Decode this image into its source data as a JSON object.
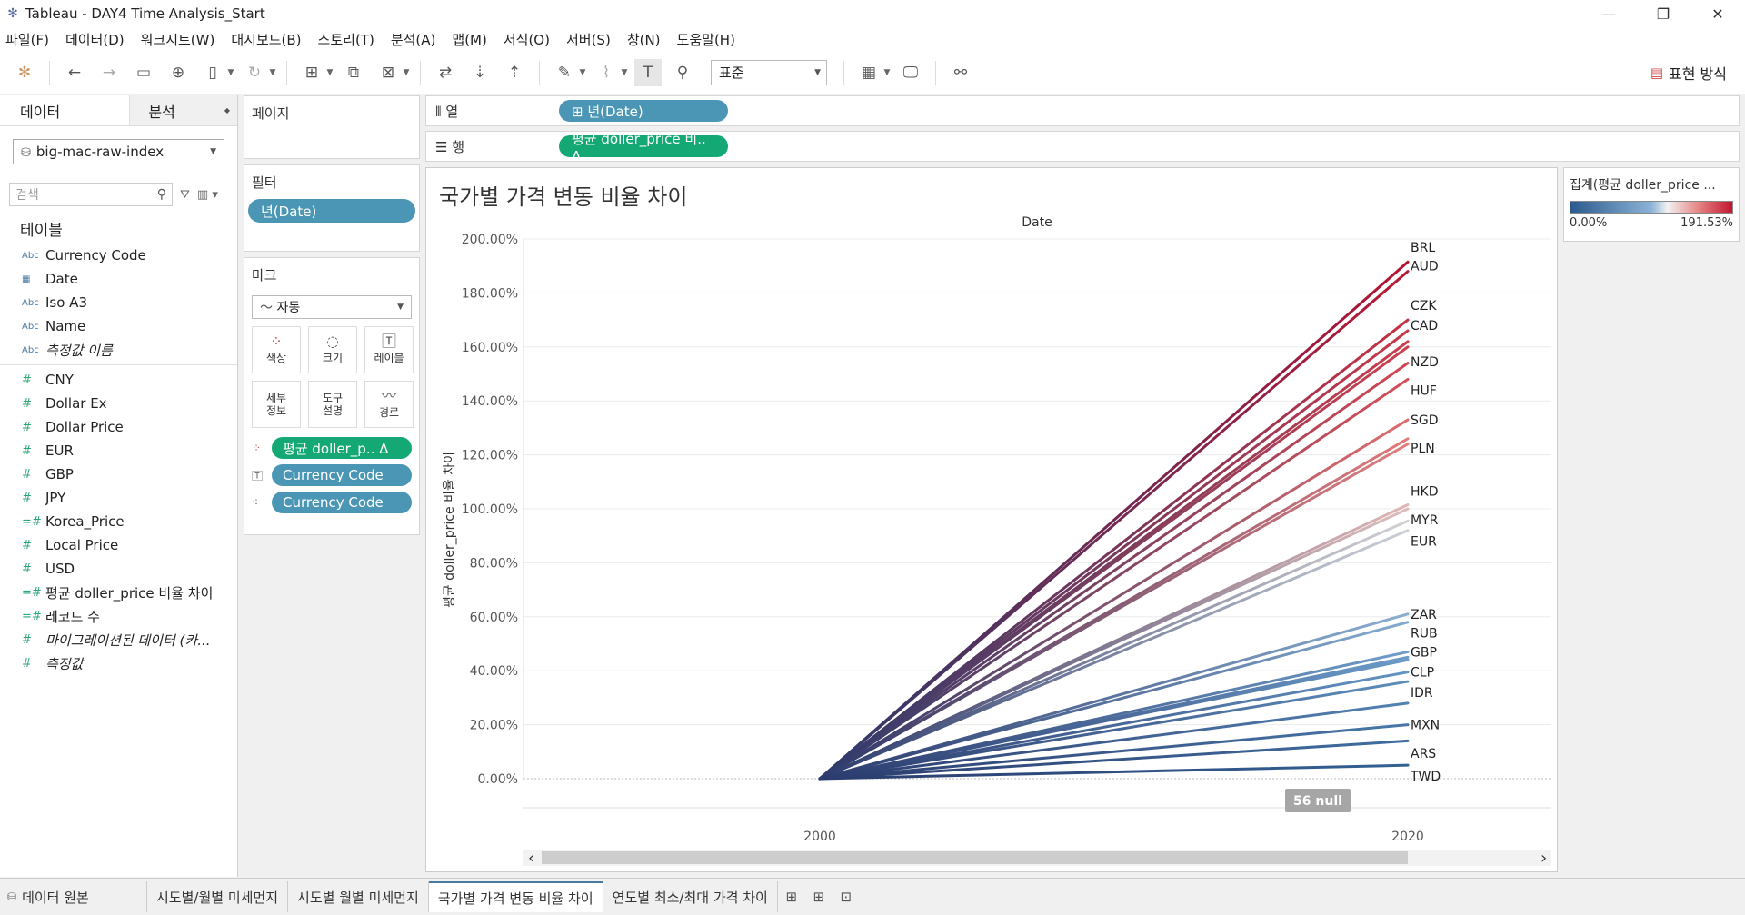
{
  "window": {
    "title": "Tableau - DAY4 Time Analysis_Start"
  },
  "menu": [
    "파일(F)",
    "데이터(D)",
    "워크시트(W)",
    "대시보드(B)",
    "스토리(T)",
    "분석(A)",
    "맵(M)",
    "서식(O)",
    "서버(S)",
    "창(N)",
    "도움말(H)"
  ],
  "toolbar": {
    "fit_value": "표준",
    "show_me_label": "표현 방식"
  },
  "left_pane": {
    "tabs": [
      "데이터",
      "분석"
    ],
    "datasource": "big-mac-raw-index",
    "search_placeholder": "검색",
    "section_title": "테이블",
    "dimensions": [
      {
        "type": "Abc",
        "name": "Currency Code"
      },
      {
        "type": "date",
        "name": "Date"
      },
      {
        "type": "Abc",
        "name": "Iso A3"
      },
      {
        "type": "Abc",
        "name": "Name"
      },
      {
        "type": "Abc",
        "name": "측정값 이름",
        "italic": true
      }
    ],
    "measures": [
      {
        "name": "CNY"
      },
      {
        "name": "Dollar Ex"
      },
      {
        "name": "Dollar Price"
      },
      {
        "name": "EUR"
      },
      {
        "name": "GBP"
      },
      {
        "name": "JPY"
      },
      {
        "name": "Korea_Price",
        "calc": true
      },
      {
        "name": "Local Price"
      },
      {
        "name": "USD"
      },
      {
        "name": "평균 doller_price 비율 차이",
        "calc": true
      },
      {
        "name": "레코드 수",
        "calc": true
      },
      {
        "name": "마이그레이션된 데이터 (카...",
        "italic": true
      },
      {
        "name": "측정값",
        "italic": true
      }
    ]
  },
  "pages": {
    "title": "페이지"
  },
  "filters": {
    "title": "필터",
    "items": [
      "년(Date)"
    ]
  },
  "marks": {
    "title": "마크",
    "type": "자동",
    "buttons": [
      "색상",
      "크기",
      "레이블",
      "세부\n정보",
      "도구\n설명",
      "경로"
    ],
    "pills": [
      {
        "kind": "color",
        "label": "평균 doller_p..  Δ",
        "color": "green"
      },
      {
        "kind": "label",
        "label": "Currency Code",
        "color": "blue"
      },
      {
        "kind": "detail",
        "label": "Currency Code",
        "color": "blue"
      }
    ]
  },
  "columns_shelf": {
    "label": "열",
    "pill": "⊞ 년(Date)"
  },
  "rows_shelf": {
    "label": "행",
    "pill": "평균 doller_price 비..  Δ"
  },
  "legend": {
    "title": "집계(평균 doller_price ...",
    "min": "0.00%",
    "max": "191.53%"
  },
  "chart_data": {
    "type": "line",
    "title": "국가별 가격 변동 비율 차이",
    "xlabel": "Date",
    "ylabel": "평균 doller_price 비율 차이",
    "x": [
      2000,
      2020
    ],
    "ylim": [
      0,
      200
    ],
    "yticks": [
      "0.00%",
      "20.00%",
      "40.00%",
      "60.00%",
      "80.00%",
      "100.00%",
      "120.00%",
      "140.00%",
      "160.00%",
      "180.00%",
      "200.00%"
    ],
    "null_badge": "56 null",
    "series": [
      {
        "name": "BRL",
        "values": [
          0,
          191.5
        ],
        "label_y": 197
      },
      {
        "name": "AUD",
        "values": [
          0,
          188
        ],
        "label_y": 190
      },
      {
        "name": "CZK",
        "values": [
          0,
          170
        ],
        "label_y": 175.5
      },
      {
        "name": "CAD",
        "values": [
          0,
          166
        ],
        "label_y": 168
      },
      {
        "name": "",
        "values": [
          0,
          162
        ]
      },
      {
        "name": "",
        "values": [
          0,
          160
        ]
      },
      {
        "name": "NZD",
        "values": [
          0,
          154
        ],
        "label_y": 154.5
      },
      {
        "name": "HUF",
        "values": [
          0,
          148
        ],
        "label_y": 144
      },
      {
        "name": "SGD",
        "values": [
          0,
          133
        ],
        "label_y": 133
      },
      {
        "name": "",
        "values": [
          0,
          126
        ]
      },
      {
        "name": "PLN",
        "values": [
          0,
          124
        ],
        "label_y": 122.5
      },
      {
        "name": "HKD",
        "values": [
          0,
          101.5
        ],
        "label_y": 106.5
      },
      {
        "name": "",
        "values": [
          0,
          100
        ]
      },
      {
        "name": "MYR",
        "values": [
          0,
          95.5
        ],
        "label_y": 96
      },
      {
        "name": "EUR",
        "values": [
          0,
          92
        ],
        "label_y": 88
      },
      {
        "name": "ZAR",
        "values": [
          0,
          61
        ],
        "label_y": 61
      },
      {
        "name": "RUB",
        "values": [
          0,
          58
        ],
        "label_y": 54
      },
      {
        "name": "GBP",
        "values": [
          0,
          47
        ],
        "label_y": 47
      },
      {
        "name": "",
        "values": [
          0,
          45
        ]
      },
      {
        "name": "",
        "values": [
          0,
          44
        ]
      },
      {
        "name": "CLP",
        "values": [
          0,
          39.5
        ],
        "label_y": 39.5
      },
      {
        "name": "",
        "values": [
          0,
          36
        ]
      },
      {
        "name": "IDR",
        "values": [
          0,
          28
        ],
        "label_y": 32
      },
      {
        "name": "MXN",
        "values": [
          0,
          20
        ],
        "label_y": 20
      },
      {
        "name": "ARS",
        "values": [
          0,
          14
        ],
        "label_y": 9.5
      },
      {
        "name": "TWD",
        "values": [
          0,
          5
        ],
        "label_y": 1
      }
    ]
  },
  "sheet_tabs": {
    "datasource_tab": "데이터 원본",
    "sheets": [
      "시도별/월별 미세먼지",
      "시도별 월별 미세먼지",
      "국가별 가격 변동 비율 차이",
      "연도별 최소/최대 가격 차이"
    ],
    "active": 2
  }
}
